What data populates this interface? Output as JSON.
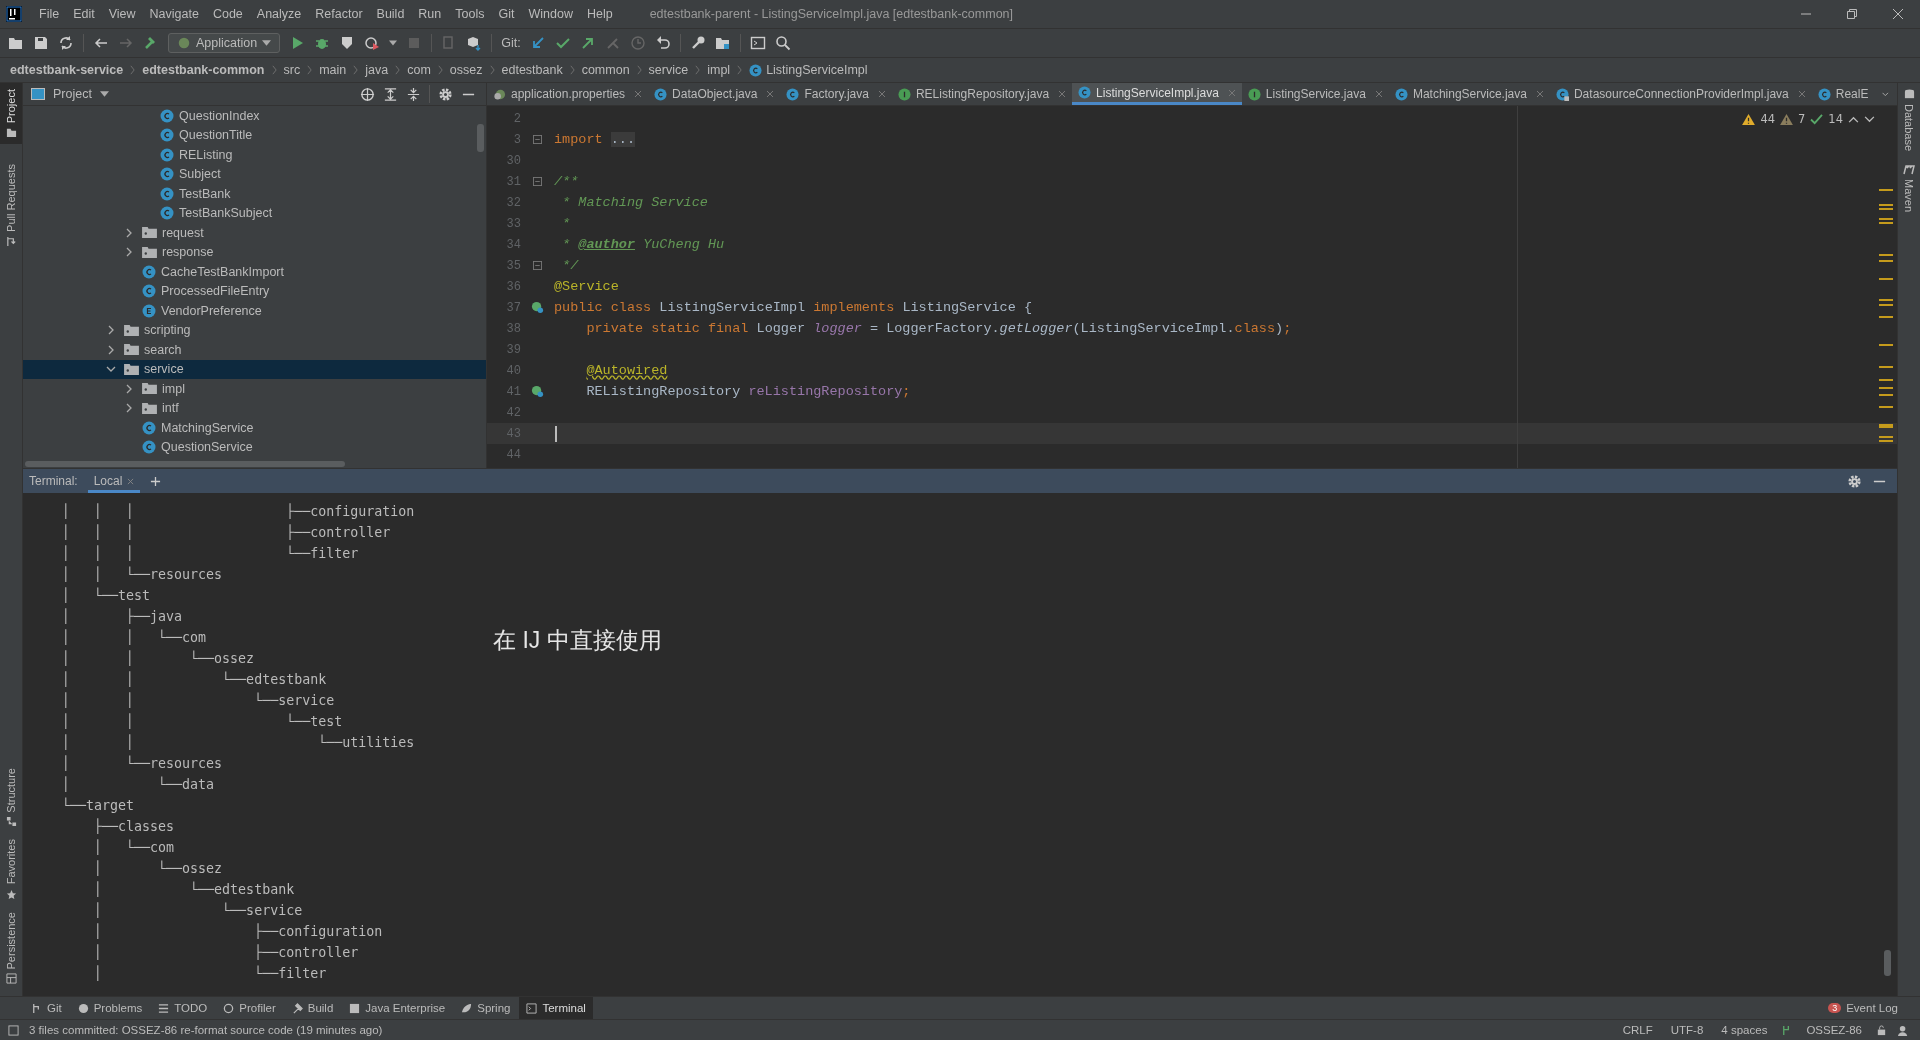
{
  "window": {
    "title": "edtestbank-parent - ListingServiceImpl.java [edtestbank-common]"
  },
  "menu": [
    "File",
    "Edit",
    "View",
    "Navigate",
    "Code",
    "Analyze",
    "Refactor",
    "Build",
    "Run",
    "Tools",
    "Git",
    "Window",
    "Help"
  ],
  "toolbar": {
    "run_config": "Application",
    "git_label": "Git:"
  },
  "breadcrumb": [
    {
      "label": "edtestbank-service",
      "bold": true
    },
    {
      "label": "edtestbank-common",
      "bold": true
    },
    {
      "label": "src",
      "bold": false
    },
    {
      "label": "main",
      "bold": false
    },
    {
      "label": "java",
      "bold": false
    },
    {
      "label": "com",
      "bold": false
    },
    {
      "label": "ossez",
      "bold": false
    },
    {
      "label": "edtestbank",
      "bold": false
    },
    {
      "label": "common",
      "bold": false
    },
    {
      "label": "service",
      "bold": false
    },
    {
      "label": "impl",
      "bold": false
    },
    {
      "label": "ListingServiceImpl",
      "bold": false,
      "kind": "class"
    }
  ],
  "left_strip": [
    {
      "label": "Project",
      "selected": true,
      "kind": "folder"
    },
    {
      "label": "Pull Requests",
      "selected": false,
      "kind": "pull"
    },
    {
      "label": "Structure",
      "selected": false,
      "kind": "structure"
    },
    {
      "label": "Favorites",
      "selected": false,
      "kind": "star"
    },
    {
      "label": "Persistence",
      "selected": false,
      "kind": "persistence"
    }
  ],
  "right_strip": [
    {
      "label": "Database",
      "kind": "database"
    },
    {
      "label": "Maven",
      "kind": "maven"
    }
  ],
  "project": {
    "title": "Project",
    "tree": [
      {
        "children": [
          {
            "children": [
              {
                "label": "QuestionIndex",
                "kind": "class",
                "selected": false
              },
              {
                "label": "QuestionTitle",
                "kind": "class",
                "selected": false
              },
              {
                "label": "REListing",
                "kind": "class",
                "selected": false
              },
              {
                "label": "Subject",
                "kind": "class",
                "selected": false
              },
              {
                "label": "TestBank",
                "kind": "class",
                "selected": false
              },
              {
                "label": "TestBankSubject",
                "kind": "class",
                "selected": false
              }
            ]
          },
          {
            "label": "request",
            "kind": "folder",
            "expanded": false,
            "selected": false
          },
          {
            "label": "response",
            "kind": "folder",
            "expanded": false,
            "selected": false
          },
          {
            "label": "CacheTestBankImport",
            "kind": "class",
            "selected": false
          },
          {
            "label": "ProcessedFileEntry",
            "kind": "class",
            "selected": false
          },
          {
            "label": "VendorPreference",
            "kind": "enum",
            "selected": false
          }
        ]
      },
      {
        "label": "scripting",
        "kind": "folder",
        "expanded": false,
        "selected": false
      },
      {
        "label": "search",
        "kind": "folder",
        "expanded": false,
        "selected": false
      },
      {
        "label": "service",
        "kind": "folder",
        "expanded": true,
        "selected": true,
        "children": [
          {
            "label": "impl",
            "kind": "folder",
            "expanded": false,
            "selected": false
          },
          {
            "label": "intf",
            "kind": "folder",
            "expanded": false,
            "selected": false
          },
          {
            "label": "MatchingService",
            "kind": "class",
            "selected": false
          },
          {
            "label": "QuestionService",
            "kind": "class",
            "selected": false
          }
        ]
      }
    ]
  },
  "editor_tabs": [
    {
      "label": "application.properties",
      "kind": "properties",
      "selected": false
    },
    {
      "label": "DataObject.java",
      "kind": "class-outline",
      "selected": false
    },
    {
      "label": "Factory.java",
      "kind": "class",
      "selected": false
    },
    {
      "label": "REListingRepository.java",
      "kind": "interface",
      "selected": false
    },
    {
      "label": "ListingServiceImpl.java",
      "kind": "class",
      "selected": true
    },
    {
      "label": "ListingService.java",
      "kind": "interface",
      "selected": false
    },
    {
      "label": "MatchingService.java",
      "kind": "class",
      "selected": false
    },
    {
      "label": "DatasourceConnectionProviderImpl.java",
      "kind": "class-locked",
      "selected": false
    },
    {
      "label": "RealE",
      "kind": "class",
      "selected": false
    }
  ],
  "inspections": {
    "warnings": "44",
    "weak_warnings": "7",
    "typos": "14"
  },
  "code": [
    {
      "number": "2",
      "current": false,
      "kind": "plain"
    },
    {
      "number": "3",
      "current": false,
      "kind": "fold",
      "tokens": [
        {
          "kind": "keyword",
          "text": "import "
        },
        {
          "kind": "folded",
          "text": "..."
        }
      ]
    },
    {
      "number": "30",
      "current": false,
      "kind": "plain"
    },
    {
      "number": "31",
      "current": false,
      "kind": "fold",
      "tokens": [
        {
          "kind": "comment",
          "text": "/**"
        }
      ]
    },
    {
      "number": "32",
      "current": false,
      "kind": "plain",
      "tokens": [
        {
          "kind": "comment",
          "text": " * Matching Service"
        }
      ]
    },
    {
      "number": "33",
      "current": false,
      "kind": "plain",
      "tokens": [
        {
          "kind": "comment",
          "text": " *"
        }
      ]
    },
    {
      "number": "34",
      "current": false,
      "kind": "plain",
      "tokens": [
        {
          "kind": "comment",
          "text": " * "
        },
        {
          "kind": "doc-tag",
          "text": "@author"
        },
        {
          "kind": "comment",
          "text": " YuCheng Hu"
        }
      ]
    },
    {
      "number": "35",
      "current": false,
      "kind": "fold",
      "tokens": [
        {
          "kind": "comment",
          "text": " */"
        }
      ]
    },
    {
      "number": "36",
      "current": false,
      "kind": "plain",
      "tokens": [
        {
          "kind": "annotation",
          "text": "@Service"
        }
      ]
    },
    {
      "number": "37",
      "current": false,
      "kind": "bean",
      "tokens": [
        {
          "kind": "keyword",
          "text": "public class "
        },
        {
          "kind": "plain",
          "text": "ListingServiceImpl "
        },
        {
          "kind": "keyword",
          "text": "implements "
        },
        {
          "kind": "plain",
          "text": "ListingService {"
        }
      ]
    },
    {
      "number": "38",
      "current": false,
      "kind": "plain",
      "indented": true,
      "tokens": [
        {
          "kind": "keyword",
          "text": "private static final "
        },
        {
          "kind": "plain",
          "text": "Logger "
        },
        {
          "kind": "static-field",
          "text": "logger"
        },
        {
          "kind": "plain",
          "text": " = LoggerFactory."
        },
        {
          "kind": "method",
          "text": "getLogger"
        },
        {
          "kind": "plain",
          "text": "(ListingServiceImpl."
        },
        {
          "kind": "keyword",
          "text": "class"
        },
        {
          "kind": "plain",
          "text": ")"
        },
        {
          "kind": "keyword",
          "text": ";"
        }
      ]
    },
    {
      "number": "39",
      "current": false,
      "kind": "plain"
    },
    {
      "number": "40",
      "current": false,
      "kind": "plain",
      "indented": true,
      "tokens": [
        {
          "kind": "annotation-warn",
          "text": "@Autowired"
        }
      ]
    },
    {
      "number": "41",
      "current": false,
      "indented": true,
      "kind": "bean",
      "tokens": [
        {
          "kind": "plain",
          "text": "REListingRepository "
        },
        {
          "kind": "field",
          "text": "reListingRepository"
        },
        {
          "kind": "keyword",
          "text": ";"
        }
      ]
    },
    {
      "number": "42",
      "current": false,
      "kind": "plain"
    },
    {
      "number": "43",
      "current": true,
      "kind": "plain"
    },
    {
      "number": "44",
      "current": false,
      "kind": "plain"
    }
  ],
  "terminal": {
    "title": "Terminal:",
    "tabs": [
      {
        "label": "Local",
        "selected": true
      }
    ],
    "lines": [
      "│   │   │                   ├──configuration",
      "│   │   │                   ├──controller",
      "│   │   │                   └──filter",
      "│   │   └──resources",
      "│   └──test",
      "│       ├──java",
      "│       │   └──com",
      "│       │       └──ossez",
      "│       │           └──edtestbank",
      "│       │               └──service",
      "│       │                   └──test",
      "│       │                       └──utilities",
      "│       └──resources",
      "│           └──data",
      "└──target",
      "    ├──classes",
      "    │   └──com",
      "    │       └──ossez",
      "    │           └──edtestbank",
      "    │               └──service",
      "    │                   ├──configuration",
      "    │                   ├──controller",
      "    │                   └──filter"
    ],
    "overlay_note": "在 IJ 中直接使用"
  },
  "tool_tabs": [
    {
      "label": "Git",
      "kind": "git",
      "selected": false
    },
    {
      "label": "Problems",
      "kind": "problems",
      "selected": false
    },
    {
      "label": "TODO",
      "kind": "todo",
      "selected": false
    },
    {
      "label": "Profiler",
      "kind": "profiler",
      "selected": false
    },
    {
      "label": "Build",
      "kind": "build",
      "selected": false
    },
    {
      "label": "Java Enterprise",
      "kind": "enterprise",
      "selected": false
    },
    {
      "label": "Spring",
      "kind": "spring",
      "selected": false
    },
    {
      "label": "Terminal",
      "kind": "terminal",
      "selected": true
    }
  ],
  "event_log": {
    "label": "Event Log",
    "count": "3"
  },
  "status_bar": {
    "message": "3 files committed: OSSEZ-86 re-format source code (19 minutes ago)",
    "line_separator": "CRLF",
    "encoding": "UTF-8",
    "indent": "4 spaces",
    "branch": "OSSEZ-86"
  }
}
